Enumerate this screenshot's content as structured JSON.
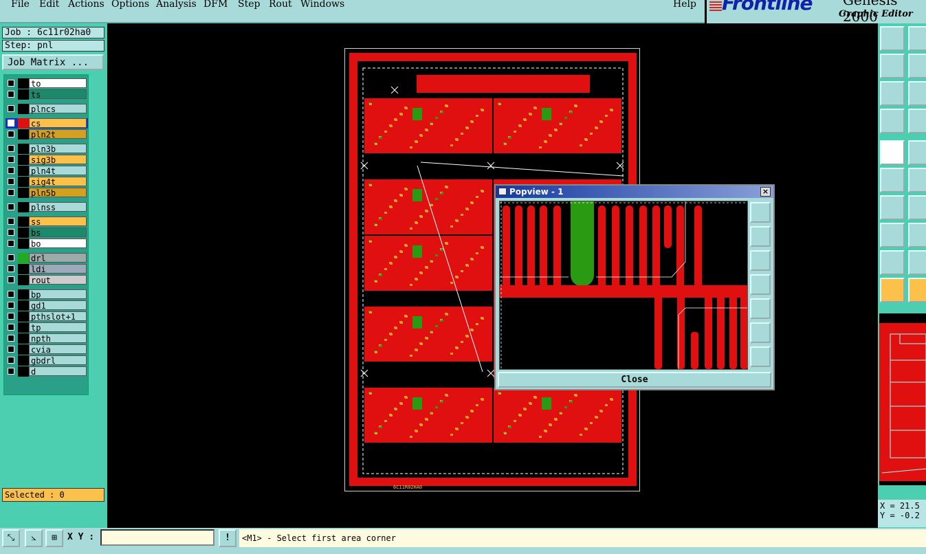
{
  "menu": {
    "items": [
      "File",
      "Edit",
      "Actions",
      "Options",
      "Analysis",
      "DFM",
      "Step",
      "Rout",
      "Windows"
    ],
    "help": "Help"
  },
  "brand": {
    "logo": "Frontline",
    "product": "Genesis 2000",
    "subtitle": "Graphic Editor"
  },
  "job": {
    "job_label": "Job : 6c11r02ha0",
    "step_label": "Step: pnl",
    "matrix_button": "Job Matrix ..."
  },
  "layers": [
    {
      "name": "to",
      "color": "#ffffff",
      "swatch": "#000000"
    },
    {
      "name": "ts",
      "color": "#1a8a6a",
      "swatch": "#000000"
    },
    {
      "name": "plncs",
      "color": "#a8dada",
      "swatch": "#000000"
    },
    {
      "name": "cs",
      "color": "#fcc14a",
      "swatch": "#e01010",
      "active": true
    },
    {
      "name": "pln2t",
      "color": "#d4a020",
      "swatch": "#000000"
    },
    {
      "name": "pln3b",
      "color": "#a8dada",
      "swatch": "#000000"
    },
    {
      "name": "sig3b",
      "color": "#fcc14a",
      "swatch": "#000000"
    },
    {
      "name": "pln4t",
      "color": "#a8dada",
      "swatch": "#000000"
    },
    {
      "name": "sig4t",
      "color": "#fcc14a",
      "swatch": "#000000"
    },
    {
      "name": "pln5b",
      "color": "#d4a020",
      "swatch": "#000000"
    },
    {
      "name": "plnss",
      "color": "#a8dada",
      "swatch": "#000000"
    },
    {
      "name": "ss",
      "color": "#fcc14a",
      "swatch": "#000000"
    },
    {
      "name": "bs",
      "color": "#1a8a6a",
      "swatch": "#000000"
    },
    {
      "name": "bo",
      "color": "#ffffff",
      "swatch": "#000000"
    },
    {
      "name": "drl",
      "color": "#9aaaa8",
      "swatch": "#22aa22"
    },
    {
      "name": "ldi",
      "color": "#9aaab8",
      "swatch": "#000000"
    },
    {
      "name": "rout",
      "color": "#cccccc",
      "swatch": "#000000"
    },
    {
      "name": "bp",
      "color": "#a8dada",
      "swatch": "#000000"
    },
    {
      "name": "gd1",
      "color": "#a8dada",
      "swatch": "#000000"
    },
    {
      "name": "pthslot+1",
      "color": "#a8dada",
      "swatch": "#000000"
    },
    {
      "name": "tp",
      "color": "#a8dada",
      "swatch": "#000000"
    },
    {
      "name": "npth",
      "color": "#a8dada",
      "swatch": "#000000"
    },
    {
      "name": "cvia",
      "color": "#a8dada",
      "swatch": "#000000"
    },
    {
      "name": "gbdrl",
      "color": "#a8dada",
      "swatch": "#000000"
    },
    {
      "name": "d",
      "color": "#a8dada",
      "swatch": "#000000"
    }
  ],
  "selected": "Selected : 0",
  "popview": {
    "title": "Popview - 1",
    "close_button": "Close"
  },
  "status": {
    "xy_label": "X Y :",
    "xy_value": "",
    "prompt": "<M1> - Select first area corner"
  },
  "coords": {
    "x": "X = 21.5",
    "y": "Y = -0.2"
  },
  "board_label": "6C11R02HA0"
}
